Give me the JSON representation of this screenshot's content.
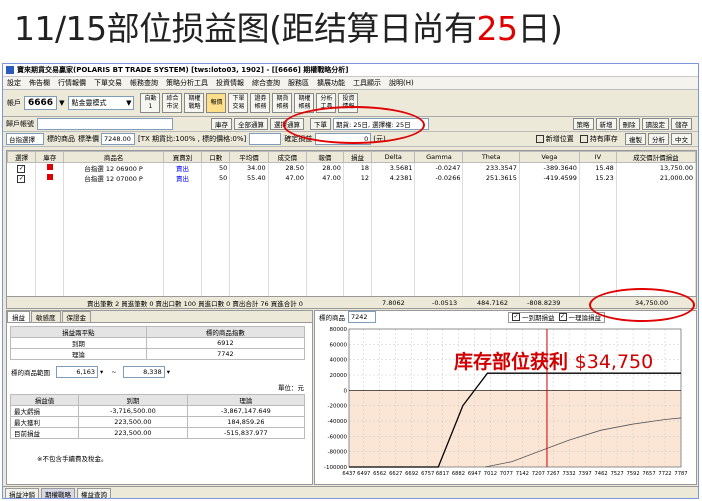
{
  "slide": {
    "title_prefix": "11/15部位损益图(距结算日尚有",
    "title_days": "25",
    "title_suffix": "日)",
    "annotation_label": "库存部位获利",
    "annotation_amount": "$34,750"
  },
  "window": {
    "title": "寶來期貨交易贏家(POLARIS BT TRADE SYSTEM) [tws:loto03, 1902] - [[6666] 期權戰略分析]"
  },
  "menu": [
    "設定",
    "佈告欄",
    "行情報價",
    "下單交易",
    "帳務查詢",
    "策略分析工具",
    "投資情報",
    "綜合查詢",
    "服務區",
    "擴展功能",
    "工具顯示",
    "說明(H)"
  ],
  "toolbar": {
    "account_label": "帳戶",
    "account_value": "6666",
    "mode_value": "點金靈模式",
    "buttons": [
      "自動\n1",
      "綜合\n市況",
      "期權\n戰略",
      "報價",
      "下單\n交易",
      "證券\n帳務",
      "期貨\n帳務",
      "期權\n帳務",
      "分析\n工具",
      "投資\n情報"
    ]
  },
  "row2": {
    "group_label": "歸戶帳號",
    "buttons": [
      "庫存",
      "全部通算",
      "選擇通算"
    ],
    "order_btn": "下單",
    "expiry_text": "期貨: 25日, 選擇權: 25日",
    "right_buttons": [
      "策略",
      "新增",
      "刪除",
      "讀設定",
      "儲存"
    ]
  },
  "row3": {
    "select_value": "台指選擇",
    "underlying_label": "標的商品",
    "underlying_price_label": "標準價",
    "underlying_price": "7248.00",
    "rate_text": "[TX 期貨比:100% , 標的價格:0%]",
    "confirm_label": "確定損益",
    "confirm_value": "0",
    "unit": "(元)",
    "new_position_label": "新增位置",
    "check_label": "持有庫存",
    "right_buttons": [
      "複製",
      "分析",
      "中文"
    ]
  },
  "grid": {
    "headers": [
      "選擇",
      "庫存",
      "商品名",
      "買賣別",
      "口數",
      "平均價",
      "成交價",
      "報價",
      "損益",
      "Delta",
      "Gamma",
      "Theta",
      "Vega",
      "IV",
      "成交價計價損益"
    ],
    "rows": [
      {
        "name": "台指選 12 06900 P",
        "side": "賣出",
        "qty": "50",
        "avg": "34.00",
        "fill": "28.50",
        "quote": "28.00",
        "pnl": "18",
        "delta": "3.5681",
        "gamma": "-0.0247",
        "theta": "233.3547",
        "vega": "-389.3640",
        "iv": "15.48",
        "value": "13,750.00"
      },
      {
        "name": "台指選 12 07000 P",
        "side": "賣出",
        "qty": "50",
        "avg": "55.40",
        "fill": "47.00",
        "quote": "47.00",
        "pnl": "12",
        "delta": "4.2381",
        "gamma": "-0.0266",
        "theta": "251.3615",
        "vega": "-419.4599",
        "iv": "15.23",
        "value": "21,000.00"
      }
    ]
  },
  "summary": {
    "text": "賣出筆數 2  買進筆數 0  賣出口數 100  買進口數 0  賣出合計 76  買進合計 0",
    "delta": "7.8062",
    "gamma": "-0.0513",
    "theta": "484.7162",
    "vega": "-808.8239",
    "total": "34,750.00"
  },
  "left_panel": {
    "tabs": [
      "損益",
      "敏感度",
      "保證金"
    ],
    "balance_headers": [
      "損益兩平點",
      "標的商品指數"
    ],
    "balance_rows": [
      [
        "到期",
        "6912"
      ],
      [
        "理論",
        "7742"
      ]
    ],
    "range_label": "標的商品範圍",
    "range_low": "6,163",
    "range_high": "8,338",
    "unit_label": "單位：元",
    "pnl_headers": [
      "損益值",
      "到期",
      "理論"
    ],
    "pnl_rows": [
      [
        "最大虧損",
        "-3,716,500.00",
        "-3,867,147.649"
      ],
      [
        "最大獲利",
        "223,500.00",
        "184,859.26"
      ],
      [
        "目前損益",
        "223,500.00",
        "-515,837.977"
      ]
    ],
    "note": "※不包含手續費及稅金。"
  },
  "chart_panel": {
    "underlying_label": "標的商品",
    "underlying_value": "7242",
    "legend_expiry": "一到期損益",
    "legend_theory": "一理論損益",
    "chart_data": {
      "type": "line",
      "x_ticks": [
        "6437",
        "6497",
        "6562",
        "6627",
        "6692",
        "6757",
        "6817",
        "6882",
        "6947",
        "7012",
        "7077",
        "7142",
        "7207",
        "7267",
        "7332",
        "7397",
        "7462",
        "7527",
        "7592",
        "7657",
        "7722",
        "7787"
      ],
      "y_ticks": [
        "80000",
        "60000",
        "40000",
        "20000",
        "0",
        "-20000",
        "-40000",
        "-60000",
        "-80000",
        "-100000"
      ],
      "ylim": [
        -100000,
        80000
      ],
      "current_x": 7242,
      "series": [
        {
          "name": "一到期損益",
          "x": [
            6437,
            6800,
            6900,
            7000,
            7787
          ],
          "y": [
            -100000,
            -100000,
            -20000,
            22350,
            22350
          ]
        },
        {
          "name": "一理論損益",
          "x": [
            6990,
            7100,
            7207,
            7332,
            7462,
            7592,
            7722,
            7787
          ],
          "y": [
            -100000,
            -93000,
            -80000,
            -65000,
            -52000,
            -44000,
            -38000,
            -36000
          ]
        }
      ]
    }
  },
  "statusbar": {
    "tabs": [
      "損益沖銷",
      "期權戰略",
      "權益查詢"
    ]
  }
}
